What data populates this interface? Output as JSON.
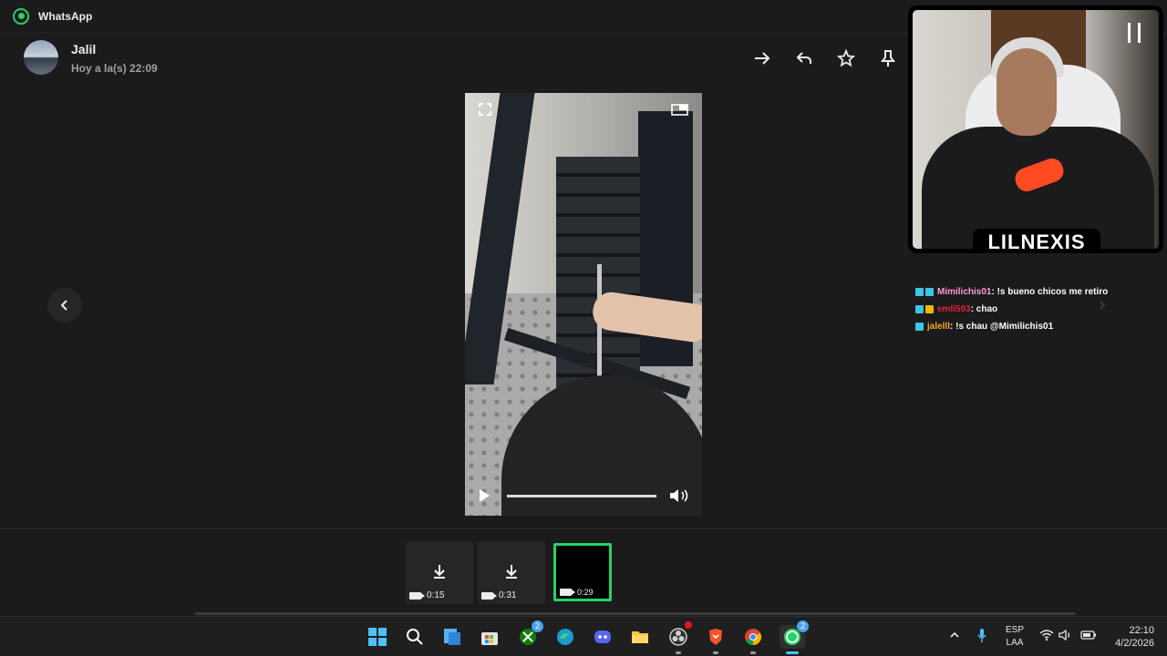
{
  "app": {
    "title": "WhatsApp",
    "accent": "#25d366"
  },
  "sender": {
    "name": "Jalil",
    "time": "Hoy a la(s) 22:09"
  },
  "toolbar": {
    "icons": [
      "forward-icon",
      "reply-icon",
      "star-icon",
      "pin-icon"
    ]
  },
  "video": {
    "progress": 0.0
  },
  "thumbnails": [
    {
      "duration": "0:15",
      "state": "download"
    },
    {
      "duration": "0:31",
      "state": "download"
    },
    {
      "duration": "0:29",
      "state": "selected"
    }
  ],
  "stream": {
    "streamer": "LILNEXIS",
    "chat": [
      {
        "user": "Mimilichis01",
        "user_color": "#ff9ad5",
        "message": " : !s bueno chicos me retiro"
      },
      {
        "user": "emli593",
        "user_color": "#e0213c",
        "message": " : chao"
      },
      {
        "user": "jalelll",
        "user_color": "#f5a623",
        "message": " : !s chau @Mimilichis01"
      }
    ]
  },
  "taskbar": {
    "apps": [
      {
        "name": "start",
        "icon": "windows-icon"
      },
      {
        "name": "search",
        "icon": "search-icon"
      },
      {
        "name": "task-view",
        "icon": "task-view-icon"
      },
      {
        "name": "store",
        "icon": "store-icon"
      },
      {
        "name": "xbox",
        "icon": "xbox-icon",
        "badge": "2"
      },
      {
        "name": "edge",
        "icon": "edge-icon"
      },
      {
        "name": "discord",
        "icon": "discord-icon"
      },
      {
        "name": "explorer",
        "icon": "folder-icon"
      },
      {
        "name": "obs",
        "icon": "obs-icon"
      },
      {
        "name": "brave",
        "icon": "brave-icon"
      },
      {
        "name": "chrome",
        "icon": "chrome-icon"
      },
      {
        "name": "whatsapp",
        "icon": "whatsapp-icon",
        "badge": "2"
      }
    ],
    "lang": {
      "line1": "ESP",
      "line2": "LAA"
    },
    "clock": {
      "time": "22:10",
      "date": "4/2/2026"
    }
  }
}
